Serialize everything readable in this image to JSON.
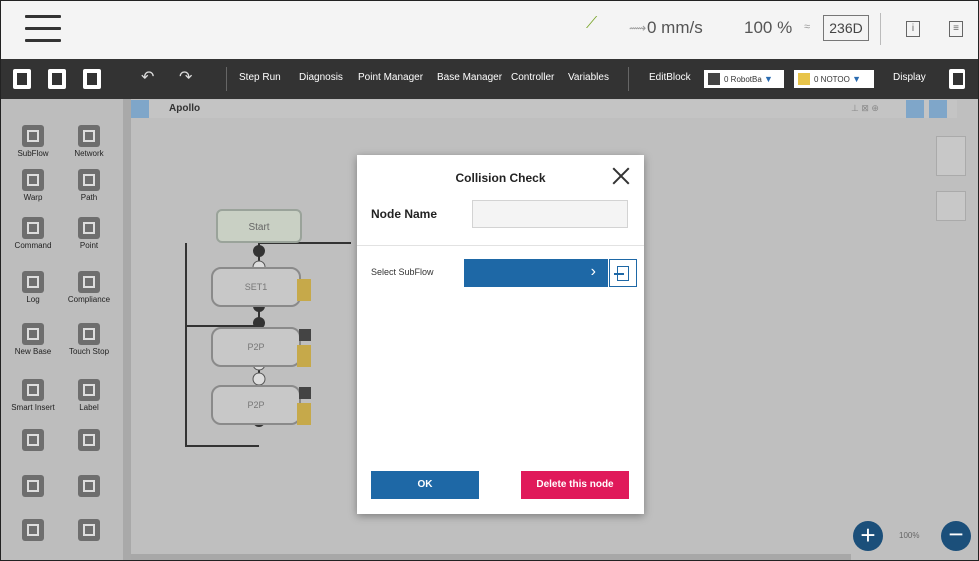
{
  "status": {
    "speed": "0 mm/s",
    "percent": "100 %",
    "counter": "236D"
  },
  "toolbar": {
    "items": [
      "Step Run",
      "Diagnosis",
      "Point Manager",
      "Base Manager",
      "Controller",
      "Variables"
    ],
    "editblock": "EditBlock",
    "robot_base": "0 RobotBa",
    "tool": "0 NOTOO",
    "display": "Display"
  },
  "palette": {
    "items": [
      "SubFlow",
      "Network",
      "Warp",
      "Path",
      "Command",
      "Point",
      "Log",
      "Compliance",
      "New Base",
      "Touch Stop",
      "Smart Insert",
      "Label"
    ]
  },
  "canvas": {
    "tab_title": "Apollo",
    "start_label": "Start",
    "node_labels": [
      "SET1",
      "P2P",
      "P2P"
    ],
    "zoom": "100%"
  },
  "dialog": {
    "title": "Collision Check",
    "node_name_label": "Node Name",
    "node_name_value": "",
    "select_subflow_label": "Select SubFlow",
    "ok_label": "OK",
    "delete_label": "Delete this node"
  },
  "colors": {
    "primary": "#1e68a6",
    "danger": "#e0195a"
  }
}
